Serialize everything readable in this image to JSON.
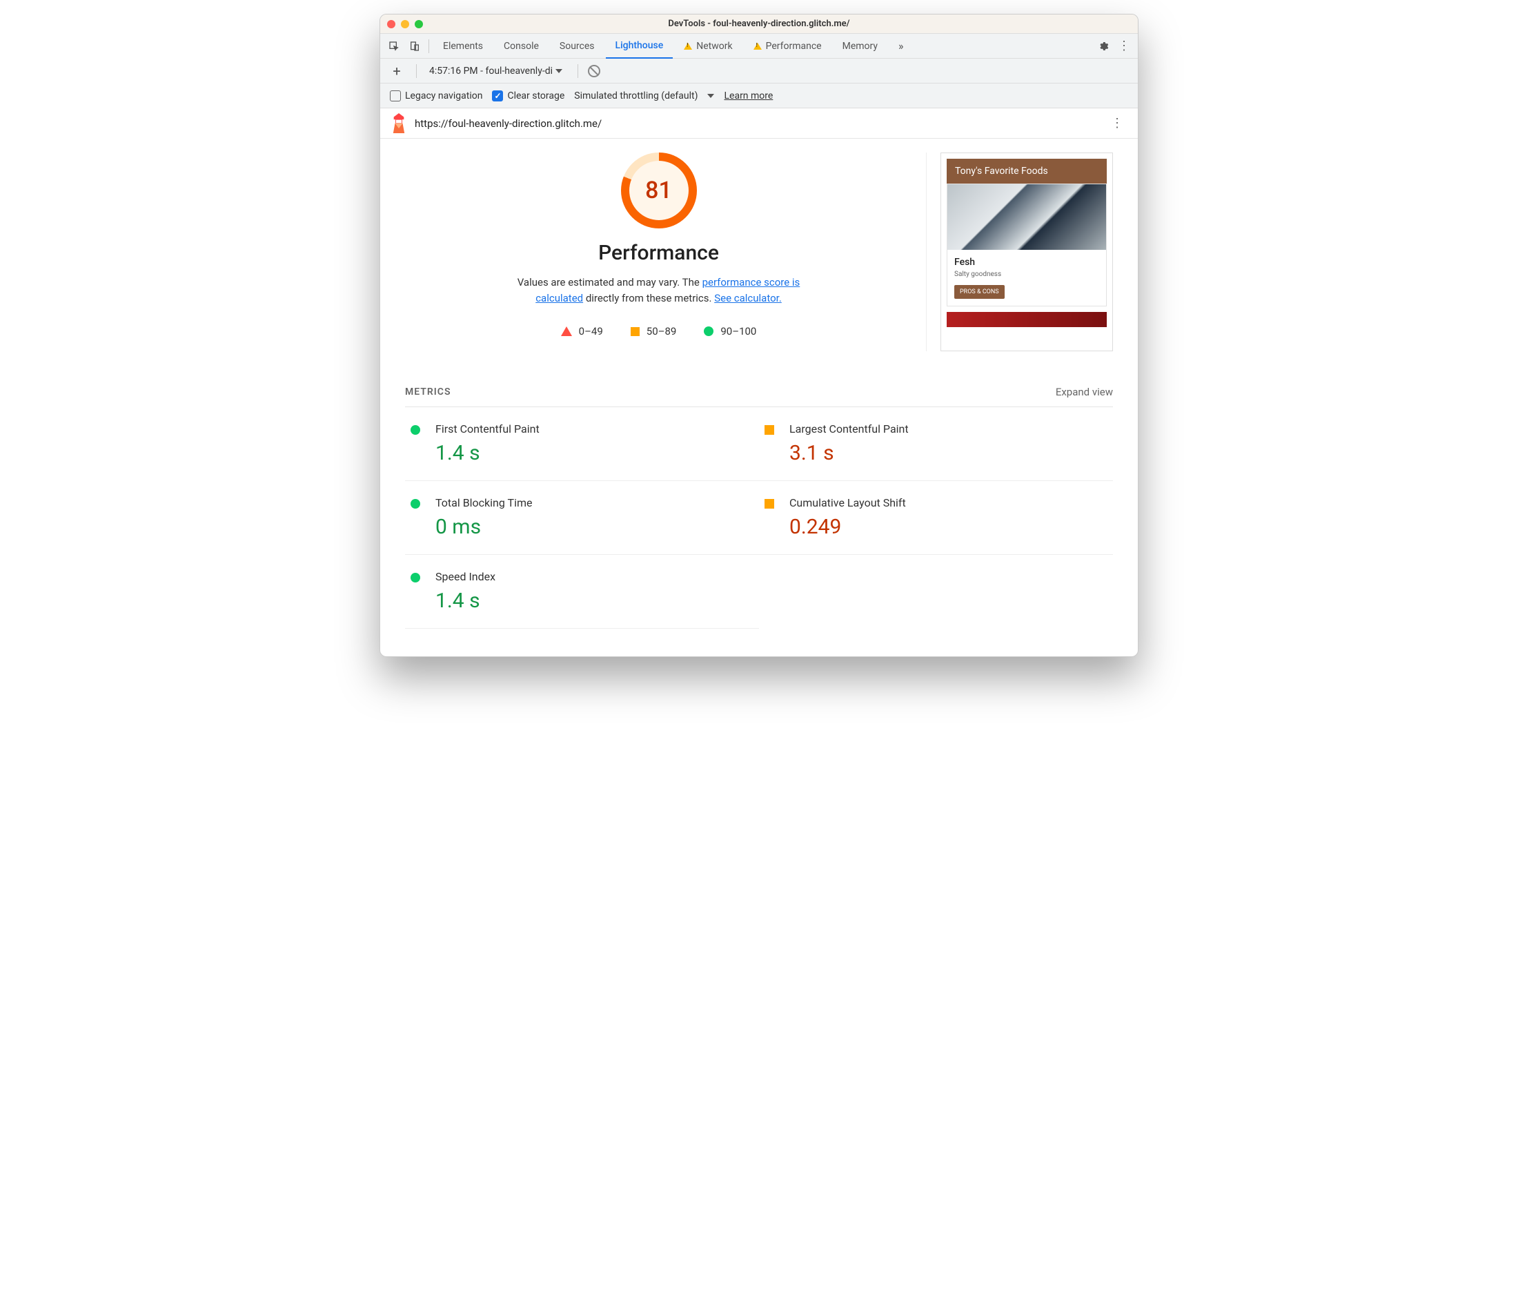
{
  "titlebar": {
    "title": "DevTools - foul-heavenly-direction.glitch.me/"
  },
  "tabs": {
    "items": [
      "Elements",
      "Console",
      "Sources",
      "Lighthouse",
      "Network",
      "Performance",
      "Memory"
    ],
    "active": "Lighthouse",
    "warn": [
      "Network",
      "Performance"
    ]
  },
  "subbar": {
    "report_label": "4:57:16 PM - foul-heavenly-di"
  },
  "optbar": {
    "legacy_label": "Legacy navigation",
    "legacy_checked": false,
    "clear_label": "Clear storage",
    "clear_checked": true,
    "throttle_label": "Simulated throttling (default)",
    "learn_label": "Learn more"
  },
  "urlrow": {
    "url": "https://foul-heavenly-direction.glitch.me/"
  },
  "report": {
    "score": "81",
    "title": "Performance",
    "desc_1": "Values are estimated and may vary. The ",
    "desc_link1": "performance score is calculated",
    "desc_2": " directly from these metrics. ",
    "desc_link2": "See calculator.",
    "legend": {
      "low": "0–49",
      "mid": "50–89",
      "high": "90–100"
    }
  },
  "preview": {
    "header": "Tony's Favorite Foods",
    "card_title": "Fesh",
    "card_sub": "Salty goodness",
    "card_btn": "PROS & CONS"
  },
  "metrics": {
    "heading": "METRICS",
    "expand": "Expand view",
    "items": [
      {
        "name": "First Contentful Paint",
        "value": "1.4 s",
        "status": "good"
      },
      {
        "name": "Largest Contentful Paint",
        "value": "3.1 s",
        "status": "avg"
      },
      {
        "name": "Total Blocking Time",
        "value": "0 ms",
        "status": "good"
      },
      {
        "name": "Cumulative Layout Shift",
        "value": "0.249",
        "status": "avg"
      },
      {
        "name": "Speed Index",
        "value": "1.4 s",
        "status": "good"
      }
    ]
  }
}
